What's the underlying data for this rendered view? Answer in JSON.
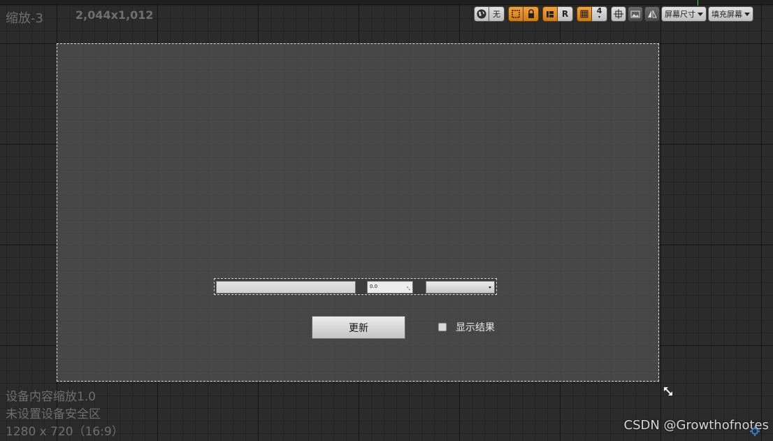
{
  "viewport": {
    "zoom_label": "缩放-3",
    "resolution_label": "2,044x1,012",
    "device_info": {
      "line1": "设备内容缩放1.0",
      "line2": "未设置设备安全区",
      "line3": "1280 x 720（16:9）"
    }
  },
  "toolbar": {
    "none_label": "无",
    "r_label": "R",
    "grid_size": "4",
    "screen_size_label": "屏幕尺寸",
    "fill_screen_label": "填充屏幕",
    "icons": {
      "world": "globe-icon",
      "outline": "outline-icon",
      "lock": "lock-icon",
      "layout": "layout-icon",
      "grid": "grid-icon",
      "transform": "transform-icon",
      "image": "image-icon",
      "mirror": "mirror-icon"
    }
  },
  "canvas": {
    "text_input_value": "",
    "spin_box_value": "0.0",
    "combo_box_value": "",
    "update_button_label": "更新",
    "checkbox_label": "显示结果",
    "checkbox_checked": false
  },
  "watermark": "CSDN @Growthofnotes",
  "colors": {
    "accent_orange": "#e8901f",
    "canvas_bg": "#474747",
    "outer_bg": "#2b2b2b",
    "ruler_marker": "#3fe03f"
  }
}
